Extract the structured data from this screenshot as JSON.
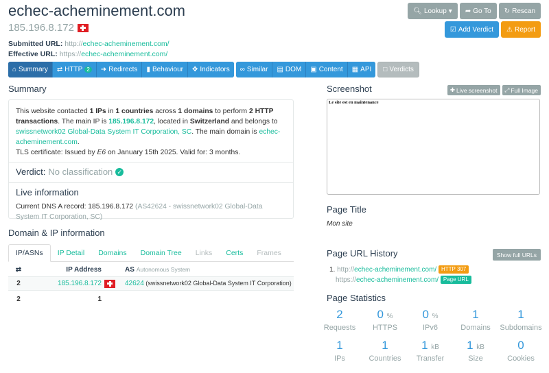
{
  "header": {
    "domain": "echec-acheminement.com",
    "ip": "185.196.8.172",
    "submitted_label": "Submitted URL:",
    "submitted_proto": "http://",
    "submitted_host": "echec-acheminement.com/",
    "effective_label": "Effective URL:",
    "effective_proto": "https://",
    "effective_host": "echec-acheminement.com/"
  },
  "actions": {
    "lookup": "Lookup",
    "goto": "Go To",
    "rescan": "Rescan",
    "add_verdict": "Add Verdict",
    "report": "Report"
  },
  "nav": {
    "summary": "Summary",
    "http": "HTTP",
    "http_count": "2",
    "redirects": "Redirects",
    "behaviour": "Behaviour",
    "indicators": "Indicators",
    "similar": "Similar",
    "dom": "DOM",
    "content": "Content",
    "api": "API",
    "verdicts": "Verdicts"
  },
  "summary": {
    "heading": "Summary",
    "p1_a": "This website contacted ",
    "ips": "1 IPs",
    "p1_b": " in ",
    "countries": "1 countries",
    "p1_c": " across ",
    "domains": "1 domains",
    "p1_d": " to perform ",
    "transactions": "2 HTTP transactions",
    "p1_e": ".",
    "p2_a": "The main IP is ",
    "main_ip": "185.196.8.172",
    "p2_b": ", located in ",
    "country": "Switzerland",
    "p2_c": " and belongs to ",
    "asn_link": "swissnetwork02 Global-Data System IT Corporation, SC",
    "p2_d": ". The main domain is ",
    "main_domain": "echec-acheminement.com",
    "p2_e": ".",
    "tls_a": "TLS certificate: Issued by ",
    "tls_issuer": "E6",
    "tls_b": " on January 15th 2025. Valid for: 3 months.",
    "verdict_label": "Verdict:",
    "verdict_value": "No classification",
    "live_heading": "Live information",
    "dns_a": "Current DNS A record: 185.196.8.172 ",
    "dns_b": "(AS42624 - swissnetwork02 Global-Data System IT Corporation, SC)"
  },
  "domain_ip": {
    "heading": "Domain & IP information",
    "tabs": [
      "IP/ASNs",
      "IP Detail",
      "Domains",
      "Domain Tree",
      "Links",
      "Certs",
      "Frames"
    ],
    "col_count": "⇄",
    "col_ip": "IP Address",
    "col_as": "AS",
    "col_as_sub": "Autonomous System",
    "rows": [
      {
        "count": "2",
        "ip": "185.196.8.172",
        "asn": "42624",
        "as_name": "(swissnetwork02 Global-Data System IT Corporation)"
      }
    ],
    "footer_count": "2",
    "footer_ips": "1"
  },
  "screenshot": {
    "heading": "Screenshot",
    "live_btn": "Live screenshot",
    "full_btn": "Full Image",
    "page_text": "Le site est en maintenance"
  },
  "page_title": {
    "heading": "Page Title",
    "value": "Mon site"
  },
  "url_history": {
    "heading": "Page URL History",
    "show_btn": "Show full URLs",
    "item_num": "1.",
    "url1_proto": "http://",
    "url1_host": "echec-acheminement.com/",
    "url1_label": "HTTP 307",
    "url2_proto": "https://",
    "url2_host": "echec-acheminement.com/",
    "url2_label": "Page URL"
  },
  "stats": {
    "heading": "Page Statistics",
    "row1": [
      {
        "value": "2",
        "unit": "",
        "label": "Requests"
      },
      {
        "value": "0",
        "unit": "%",
        "label": "HTTPS"
      },
      {
        "value": "0",
        "unit": "%",
        "label": "IPv6"
      },
      {
        "value": "1",
        "unit": "",
        "label": "Domains"
      },
      {
        "value": "1",
        "unit": "",
        "label": "Subdomains"
      }
    ],
    "row2": [
      {
        "value": "1",
        "unit": "",
        "label": "IPs"
      },
      {
        "value": "1",
        "unit": "",
        "label": "Countries"
      },
      {
        "value": "1",
        "unit": "kB",
        "label": "Transfer"
      },
      {
        "value": "1",
        "unit": "kB",
        "label": "Size"
      },
      {
        "value": "0",
        "unit": "",
        "label": "Cookies"
      }
    ]
  }
}
